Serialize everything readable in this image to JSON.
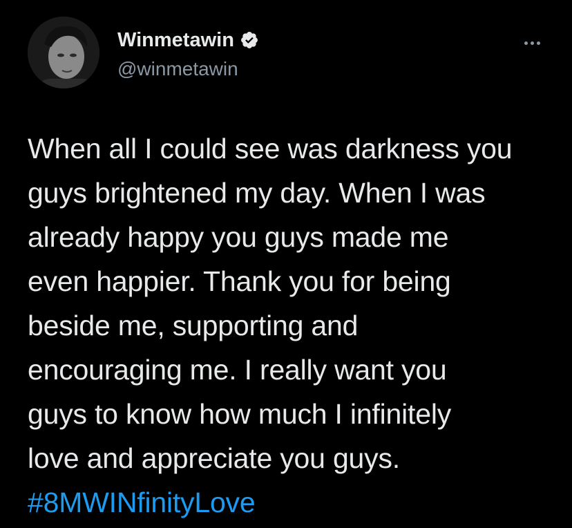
{
  "tweet": {
    "author": {
      "display_name": "Winmetawin",
      "handle": "@winmetawin",
      "verified": true,
      "avatar_icon": "profile-photo"
    },
    "more_icon": "ellipsis-icon",
    "body_lines": [
      "When all I could see was darkness you",
      "guys brightened my day. When I was",
      "already happy you guys made me",
      "even happier. Thank you for being",
      "beside me, supporting and",
      "encouraging me. I really want you",
      "guys to know how much I infinitely",
      "love and appreciate you guys."
    ],
    "hashtag": "#8MWINfinityLove"
  },
  "colors": {
    "background": "#000000",
    "text": "#e7e9ea",
    "secondary_text": "#8b98a5",
    "link": "#1d9bf0"
  }
}
